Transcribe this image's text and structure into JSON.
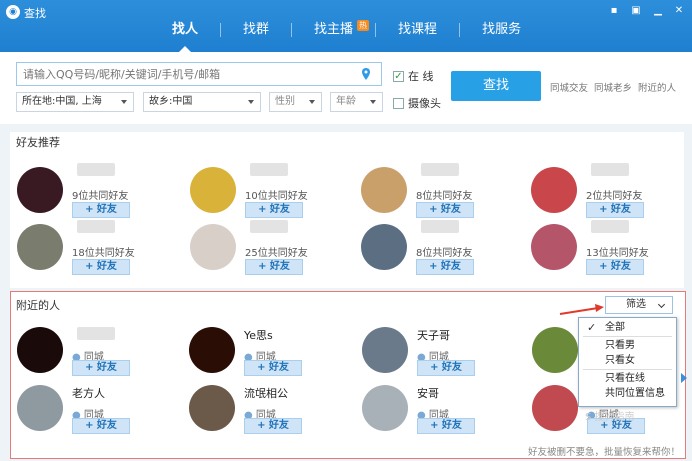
{
  "app": {
    "title": "查找"
  },
  "tabs": [
    {
      "label": "找人",
      "active": true
    },
    {
      "label": "找群",
      "active": false
    },
    {
      "label": "找主播",
      "active": false,
      "badge": "热"
    },
    {
      "label": "找课程",
      "active": false
    },
    {
      "label": "找服务",
      "active": false
    }
  ],
  "search": {
    "placeholder": "请输入QQ号码/昵称/关键词/手机号/邮箱",
    "online_label": "在 线",
    "online_checked": true,
    "camera_label": "摄像头",
    "camera_checked": false,
    "location": "所在地:中国, 上海",
    "hometown": "故乡:中国",
    "gender": "性别",
    "age": "年龄",
    "button": "查找",
    "quick_links": [
      "同城交友",
      "同城老乡",
      "附近的人"
    ]
  },
  "friends": {
    "title": "好友推荐",
    "add_label": "+ 好友",
    "cards": [
      {
        "mutual": "9位共同好友",
        "avatar_color": "#3a1a22"
      },
      {
        "mutual": "10位共同好友",
        "avatar_color": "#d9b23a"
      },
      {
        "mutual": "8位共同好友",
        "avatar_color": "#caa06a"
      },
      {
        "mutual": "2位共同好友",
        "avatar_color": "#c9474a"
      },
      {
        "mutual": "18位共同好友",
        "avatar_color": "#7a7d6e"
      },
      {
        "mutual": "25位共同好友",
        "avatar_color": "#d7cfc8"
      },
      {
        "mutual": "8位共同好友",
        "avatar_color": "#5b6e82"
      },
      {
        "mutual": "13位共同好友",
        "avatar_color": "#b4556a"
      }
    ]
  },
  "nearby": {
    "title": "附近的人",
    "filter_label": "筛选",
    "add_label": "+ 好友",
    "cards": [
      {
        "name": "",
        "loc": "同城",
        "avatar_color": "#1a0a0a"
      },
      {
        "name": "Ye思s",
        "loc": "同城",
        "avatar_color": "#2a0d05"
      },
      {
        "name": "天子哥",
        "loc": "同城",
        "avatar_color": "#6a7a8a"
      },
      {
        "name": "",
        "loc": "同城",
        "avatar_color": "#6a8a3a"
      },
      {
        "name": "老方人",
        "loc": "同城",
        "avatar_color": "#8e9aa0"
      },
      {
        "name": "流氓相公",
        "loc": "同城",
        "avatar_color": "#6b5a4a"
      },
      {
        "name": "安哥",
        "loc": "同城",
        "avatar_color": "#a8b0b8"
      },
      {
        "name": "",
        "loc": "同城",
        "avatar_color": "#c04a50"
      }
    ],
    "filter_menu": [
      {
        "label": "全部",
        "checked": true
      },
      {
        "label": "只看男",
        "checked": false
      },
      {
        "label": "只看女",
        "checked": false
      },
      {
        "label": "只看在线",
        "checked": false
      },
      {
        "label": "共同位置信息",
        "checked": false
      }
    ]
  },
  "footer": {
    "note": "好友被删不要急，批量恢复来帮你！"
  },
  "colors": {
    "accent": "#27a0e6",
    "titlebar": "#1f7fd0",
    "highlight_border": "#e47a7a",
    "arrow": "#e03a2a"
  }
}
